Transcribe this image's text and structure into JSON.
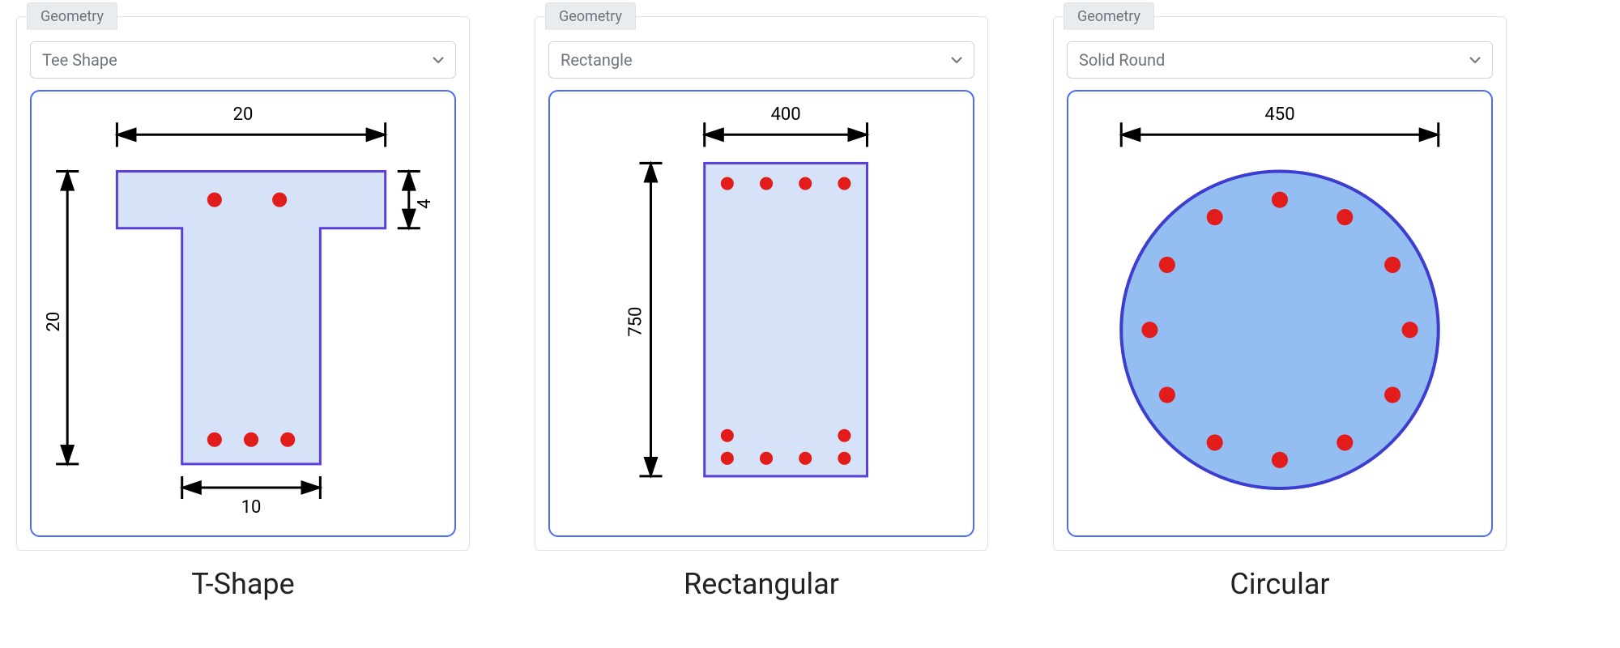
{
  "panels": [
    {
      "tab": "Geometry",
      "shape_selected": "Tee Shape",
      "caption": "T-Shape",
      "dims": {
        "width_top": "20",
        "height_total": "20",
        "flange_thickness": "4",
        "web_width": "10"
      }
    },
    {
      "tab": "Geometry",
      "shape_selected": "Rectangle",
      "caption": "Rectangular",
      "dims": {
        "width": "400",
        "height": "750"
      }
    },
    {
      "tab": "Geometry",
      "shape_selected": "Solid Round",
      "caption": "Circular",
      "dims": {
        "diameter": "450"
      }
    }
  ]
}
